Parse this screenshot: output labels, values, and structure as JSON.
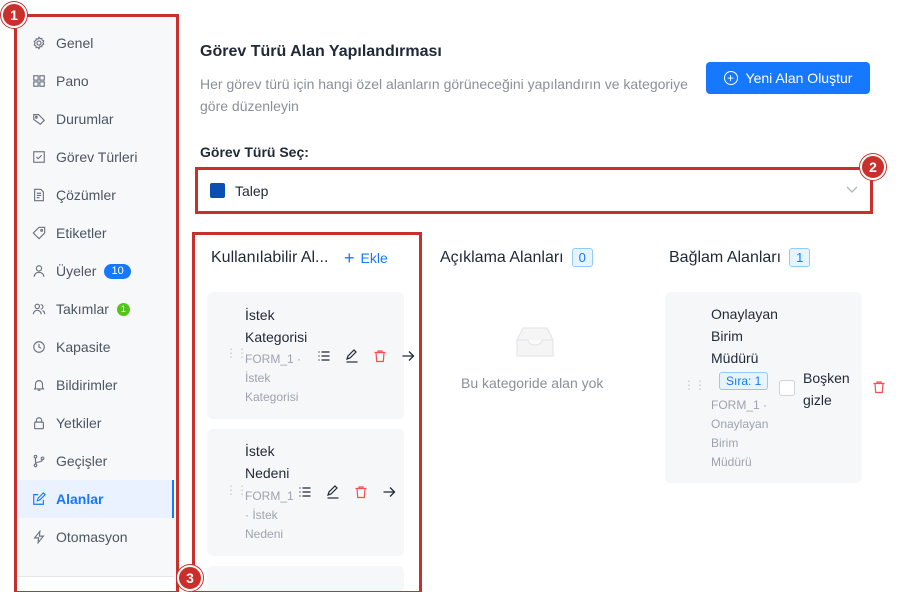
{
  "sidebar": {
    "items": [
      {
        "label": "Genel",
        "icon": "gear-icon"
      },
      {
        "label": "Pano",
        "icon": "grid-icon"
      },
      {
        "label": "Durumlar",
        "icon": "tag-icon"
      },
      {
        "label": "Görev Türleri",
        "icon": "checkbox-icon"
      },
      {
        "label": "Çözümler",
        "icon": "document-icon"
      },
      {
        "label": "Etiketler",
        "icon": "label-icon"
      },
      {
        "label": "Üyeler",
        "icon": "user-icon",
        "badge": "10"
      },
      {
        "label": "Takımlar",
        "icon": "team-icon",
        "badge": "1"
      },
      {
        "label": "Kapasite",
        "icon": "clock-icon"
      },
      {
        "label": "Bildirimler",
        "icon": "bell-icon"
      },
      {
        "label": "Yetkiler",
        "icon": "lock-icon"
      },
      {
        "label": "Geçişler",
        "icon": "branch-icon"
      },
      {
        "label": "Alanlar",
        "icon": "edit-square-icon",
        "active": true
      },
      {
        "label": "Otomasyon",
        "icon": "bolt-icon"
      }
    ]
  },
  "markers": {
    "m1": "1",
    "m2": "2",
    "m3": "3"
  },
  "header": {
    "title": "Görev Türü Alan Yapılandırması",
    "description": "Her görev türü için hangi özel alanların görüneceğini yapılandırın ve kategoriye göre düzenleyin",
    "new_field_button": "Yeni Alan Oluştur"
  },
  "selector": {
    "label": "Görev Türü Seç:",
    "selected": "Talep",
    "swatch_color": "#0b4fb3"
  },
  "columns": {
    "available": {
      "title": "Kullanılabilir Al...",
      "add_label": "Ekle",
      "cards": [
        {
          "title_l1": "İstek",
          "title_l2": "Kategorisi",
          "sub_l1": "FORM_1 ·",
          "sub_l2": "İstek",
          "sub_l3": "Kategorisi"
        },
        {
          "title_l1": "İstek",
          "title_l2": "Nedeni",
          "sub_l1": "FORM_1",
          "sub_l2": "· İstek",
          "sub_l3": "Nedeni"
        }
      ]
    },
    "description": {
      "title": "Açıklama Alanları",
      "count": "0",
      "empty_text": "Bu kategoride alan yok"
    },
    "context": {
      "title": "Bağlam Alanları",
      "count": "1",
      "card": {
        "title_l1": "Onaylayan",
        "title_l2": "Birim",
        "title_l3": "Müdürü",
        "order": "Sıra: 1",
        "checkbox_l1": "Boşken",
        "checkbox_l2": "gizle",
        "sub_l1": "FORM_1 ·",
        "sub_l2": "Onaylayan",
        "sub_l3": "Birim",
        "sub_l4": "Müdürü"
      }
    }
  },
  "colors": {
    "accent": "#1677ff",
    "annotation": "#c9302c",
    "danger": "#ff4d4f"
  }
}
